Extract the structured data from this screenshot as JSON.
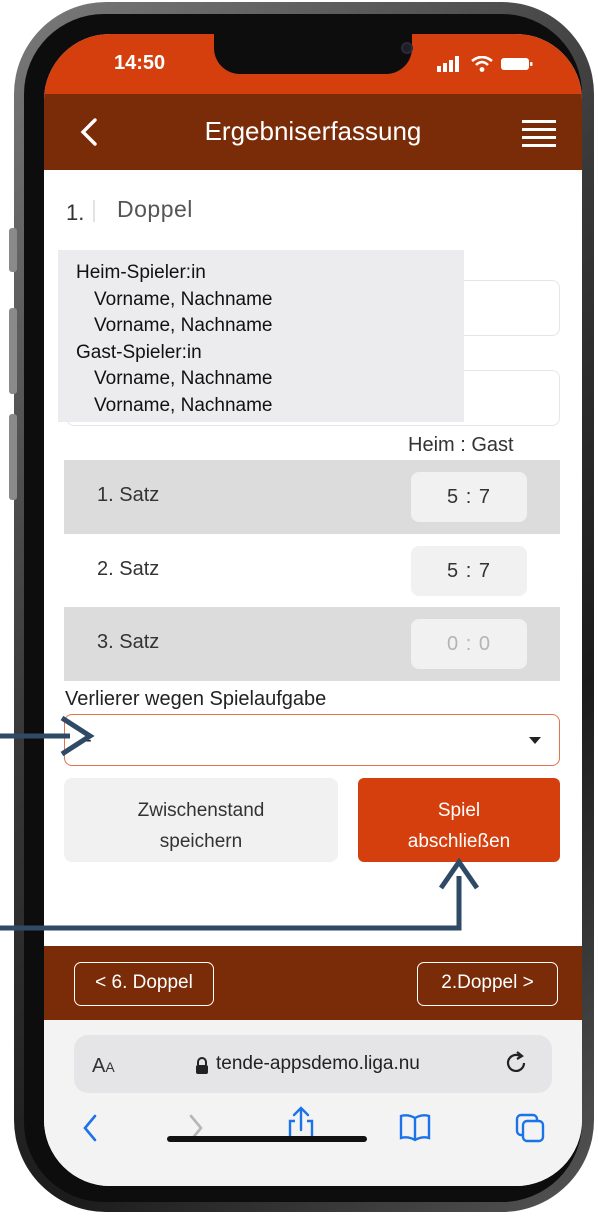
{
  "status": {
    "time": "14:50"
  },
  "header": {
    "title": "Ergebniserfassung"
  },
  "match": {
    "number": "1.",
    "name": "Doppel"
  },
  "tooltip": {
    "lines": [
      {
        "text": "Heim-Spieler:in",
        "indent": false
      },
      {
        "text": "Vorname, Nachname",
        "indent": true
      },
      {
        "text": "Vorname, Nachname",
        "indent": true
      },
      {
        "text": "Gast-Spieler:in",
        "indent": false
      },
      {
        "text": "Vorname, Nachname",
        "indent": true
      },
      {
        "text": "Vorname, Nachname",
        "indent": true
      }
    ]
  },
  "score_header": "Heim : Gast",
  "sets": [
    {
      "label": "1. Satz",
      "score": "5 : 7",
      "dim": false
    },
    {
      "label": "2. Satz",
      "score": "5 : 7",
      "dim": false
    },
    {
      "label": "3. Satz",
      "score": "0 : 0",
      "dim": true
    }
  ],
  "loser": {
    "label": "Verlierer wegen Spielaufgabe",
    "value": "-"
  },
  "buttons": {
    "save_line1": "Zwischenstand",
    "save_line2": "speichern",
    "finish_line1": "Spiel",
    "finish_line2": "abschließen"
  },
  "nav": {
    "prev": "< 6. Doppel",
    "next": "2.Doppel >"
  },
  "browser": {
    "aa_big": "A",
    "aa_small": "A",
    "url": "tende-appsdemo.liga.nu"
  },
  "colors": {
    "brand_dark": "#7a2b08",
    "brand_orange": "#d43f0d",
    "arrow": "#2e4a66"
  },
  "icons": [
    "signal-icon",
    "wifi-icon",
    "battery-icon",
    "back-chevron-icon",
    "hamburger-menu-icon",
    "lock-icon",
    "reload-icon",
    "browser-back-icon",
    "browser-forward-icon",
    "share-icon",
    "bookmarks-icon",
    "tabs-icon"
  ]
}
